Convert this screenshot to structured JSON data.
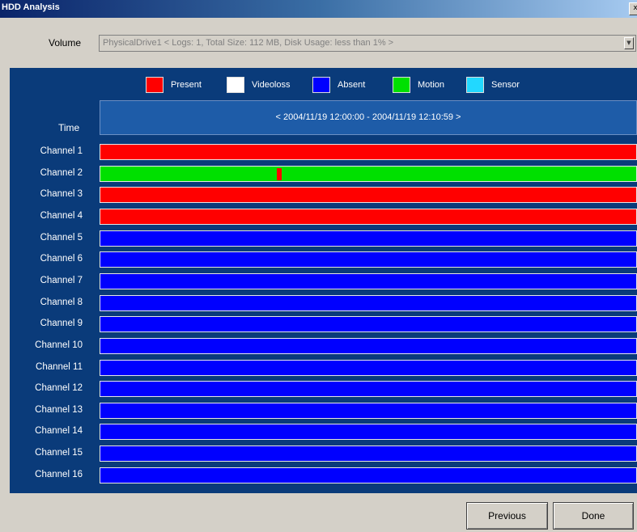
{
  "window": {
    "title": "HDD Analysis",
    "close_glyph": "x"
  },
  "volume": {
    "label": "Volume",
    "selected": "PhysicalDrive1  < Logs: 1, Total Size: 112 MB, Disk Usage: less than 1% >",
    "arrow_glyph": "▼"
  },
  "legend": [
    {
      "label": "Present",
      "color": "#ff0000"
    },
    {
      "label": "Videoloss",
      "color": "#ffffff"
    },
    {
      "label": "Absent",
      "color": "#0000ff"
    },
    {
      "label": "Motion",
      "color": "#00e000"
    },
    {
      "label": "Sensor",
      "color": "#22d8ff"
    }
  ],
  "timeline": {
    "label": "Time",
    "range": "< 2004/11/19 12:00:00 - 2004/11/19 12:10:59 >"
  },
  "channels": [
    {
      "label": "Channel 1",
      "state": "Present"
    },
    {
      "label": "Channel 2",
      "state": "Motion",
      "event": {
        "state": "Present",
        "position_fraction": 0.33
      }
    },
    {
      "label": "Channel 3",
      "state": "Present"
    },
    {
      "label": "Channel 4",
      "state": "Present"
    },
    {
      "label": "Channel 5",
      "state": "Absent"
    },
    {
      "label": "Channel 6",
      "state": "Absent"
    },
    {
      "label": "Channel 7",
      "state": "Absent"
    },
    {
      "label": "Channel 8",
      "state": "Absent"
    },
    {
      "label": "Channel 9",
      "state": "Absent"
    },
    {
      "label": "Channel 10",
      "state": "Absent"
    },
    {
      "label": "Channel 11",
      "state": "Absent"
    },
    {
      "label": "Channel 12",
      "state": "Absent"
    },
    {
      "label": "Channel 13",
      "state": "Absent"
    },
    {
      "label": "Channel 14",
      "state": "Absent"
    },
    {
      "label": "Channel 15",
      "state": "Absent"
    },
    {
      "label": "Channel 16",
      "state": "Absent"
    }
  ],
  "buttons": {
    "previous": "Previous",
    "done": "Done"
  }
}
